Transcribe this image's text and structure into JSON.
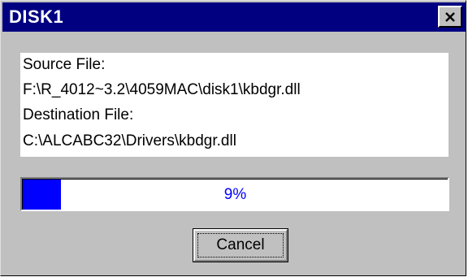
{
  "window": {
    "title": "DISK1",
    "close_icon": "close-x-icon",
    "titlebar_color": "#000080"
  },
  "info": {
    "source_label": "Source File:",
    "source_path": "F:\\R_4012~3.2\\4059MAC\\disk1\\kbdgr.dll",
    "destination_label": "Destination File:",
    "destination_path": "C:\\ALCABC32\\Drivers\\kbdgr.dll"
  },
  "progress": {
    "percent": 9,
    "label": "9%",
    "fill_color": "#0000ff"
  },
  "buttons": {
    "cancel_label": "Cancel"
  }
}
